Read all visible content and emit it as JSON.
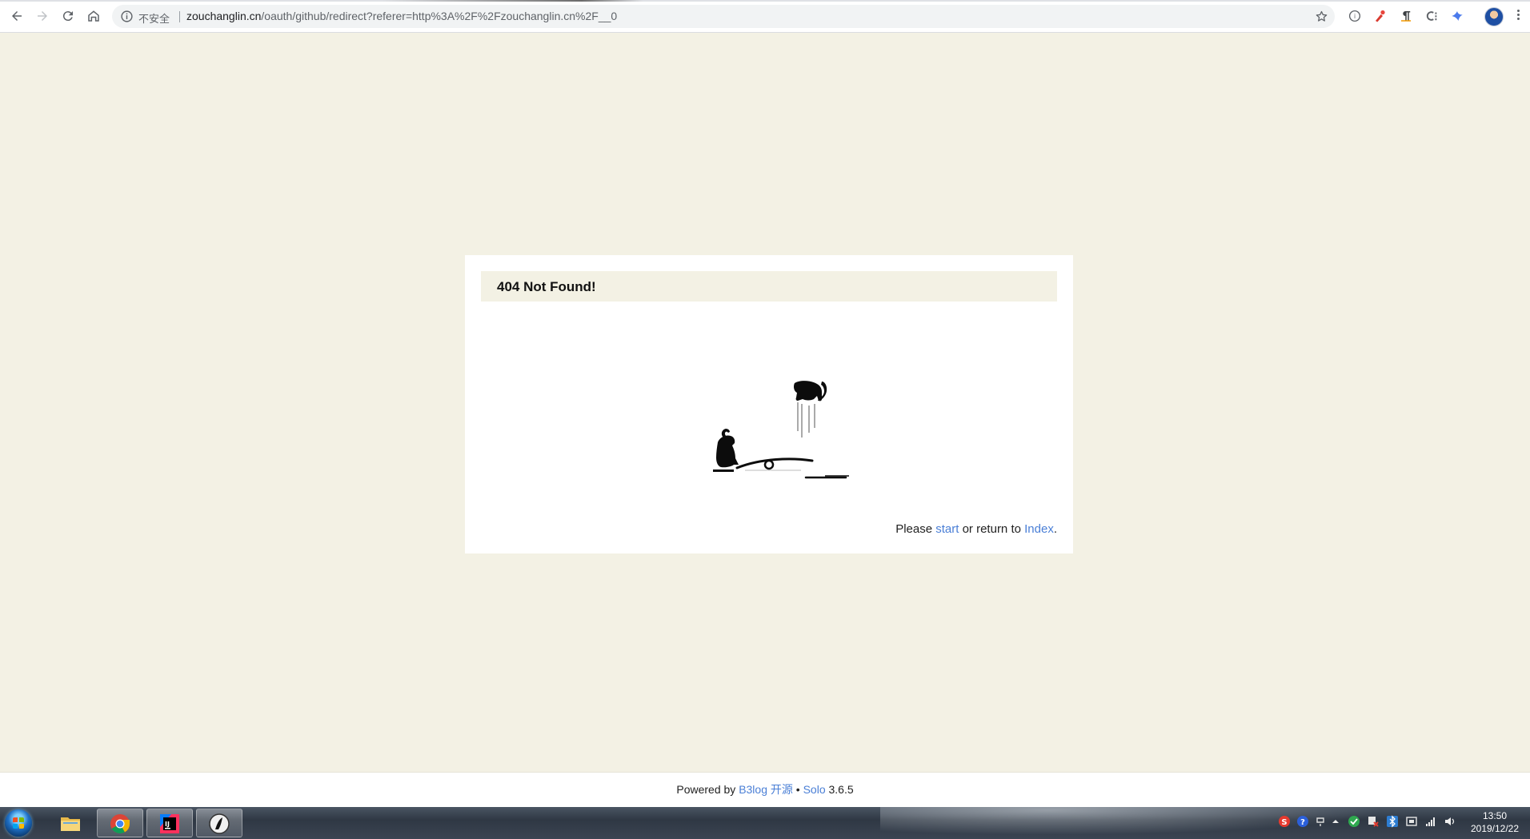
{
  "browser": {
    "security_label": "不安全",
    "url_host": "zouchanglin.cn",
    "url_path": "/oauth/github/redirect?referer=http%3A%2F%2Fzouchanglin.cn%2F__0"
  },
  "error_card": {
    "title": "404 Not Found!",
    "message_prefix": "Please ",
    "start_link": "start",
    "message_middle": " or return to ",
    "index_link": "Index",
    "message_suffix": "."
  },
  "footer": {
    "powered_by": "Powered by ",
    "b3log_link": "B3log 开源",
    "bullet": " • ",
    "solo_link": "Solo",
    "version": " 3.6.5"
  },
  "taskbar": {
    "time": "13:50",
    "date": "2019/12/22"
  },
  "colors": {
    "page_background": "#f3f1e4",
    "link": "#4a7fd6",
    "card_background": "#ffffff"
  }
}
